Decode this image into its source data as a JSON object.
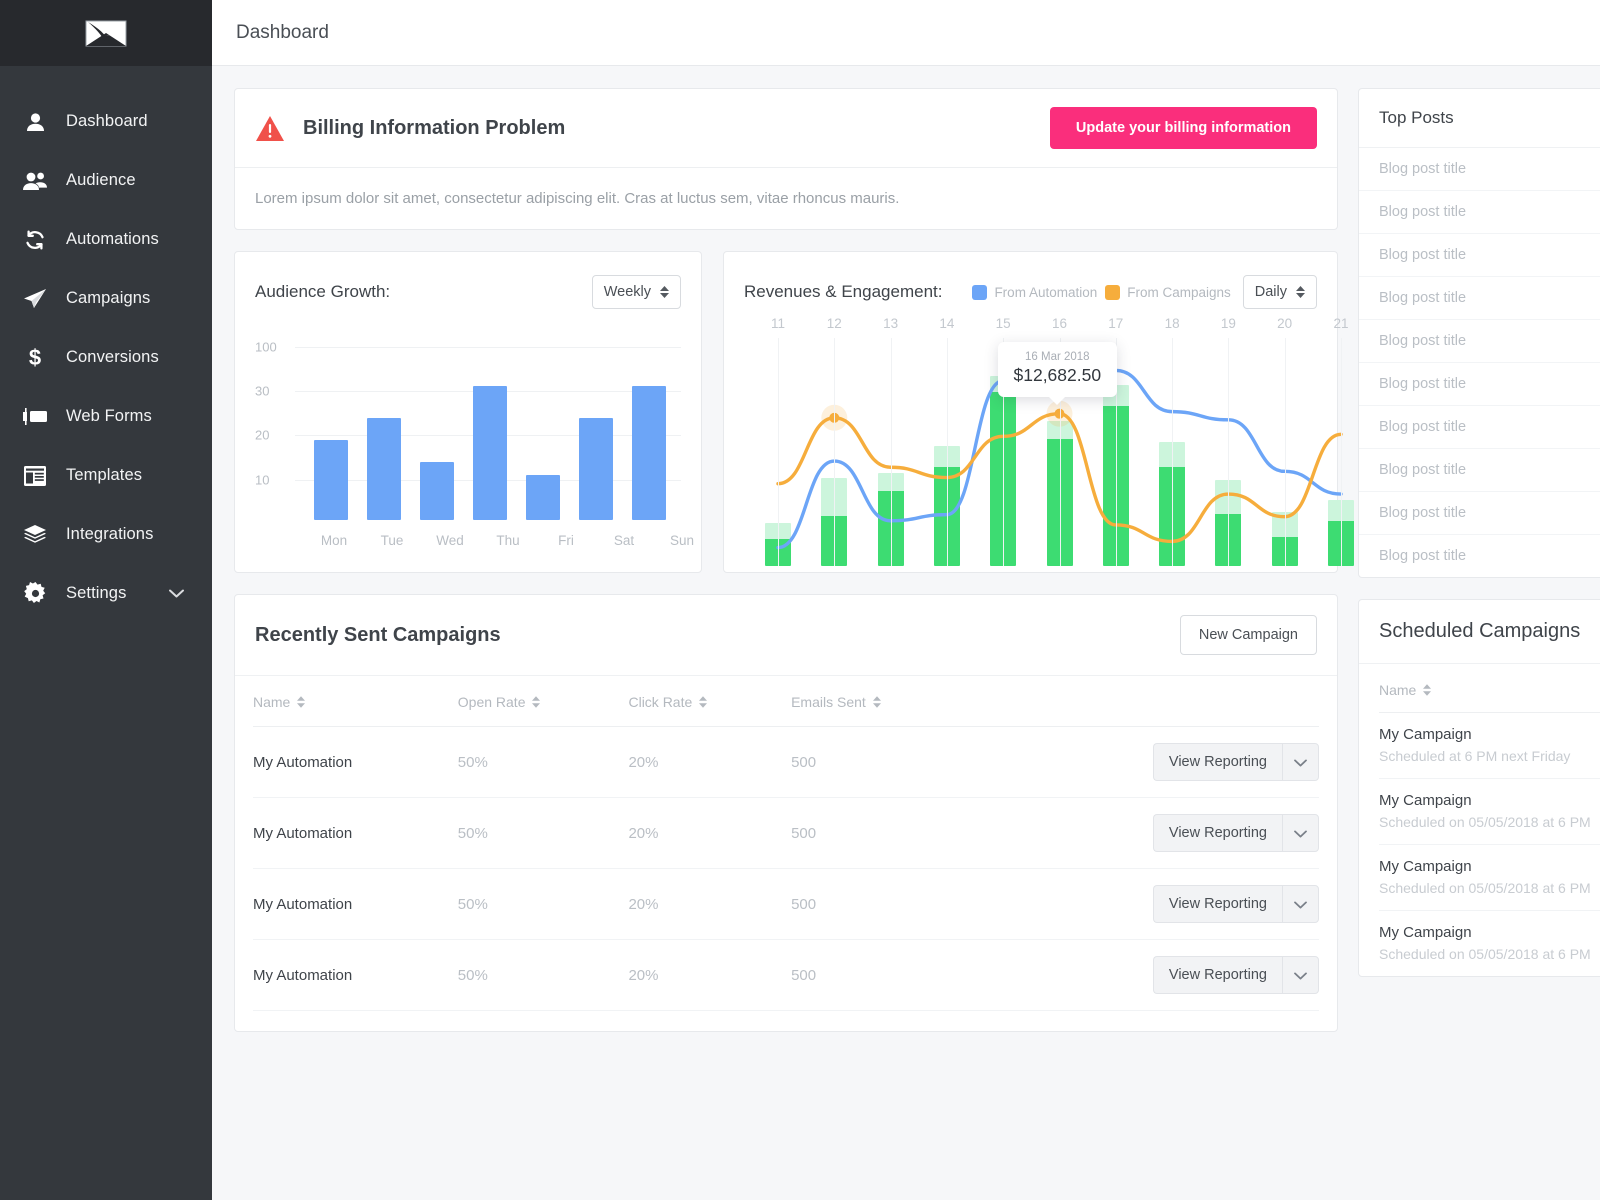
{
  "colors": {
    "brand_pink": "#FA2E7C",
    "sidebar_bg": "#34383D",
    "logo_bg": "#27292D",
    "series_blue": "#6CA5F7",
    "series_orange": "#F6AD3C",
    "bar_green": "#3DDC72",
    "bar_green_light": "#CCF5DC",
    "alert_red": "#F0514A"
  },
  "sidebar": {
    "logo_icon": "envelope-logo-icon",
    "items": [
      {
        "label": "Dashboard",
        "icon": "user-icon"
      },
      {
        "label": "Audience",
        "icon": "users-icon"
      },
      {
        "label": "Automations",
        "icon": "refresh-cycle-icon"
      },
      {
        "label": "Campaigns",
        "icon": "paper-plane-icon"
      },
      {
        "label": "Conversions",
        "icon": "dollar-sign-icon"
      },
      {
        "label": "Web Forms",
        "icon": "web-form-icon"
      },
      {
        "label": "Templates",
        "icon": "template-icon"
      },
      {
        "label": "Integrations",
        "icon": "layers-icon"
      },
      {
        "label": "Settings",
        "icon": "gear-icon",
        "caret": "chevron-down-icon"
      }
    ]
  },
  "topbar": {
    "title": "Dashboard"
  },
  "alert": {
    "icon": "warning-triangle-icon",
    "title": "Billing Information Problem",
    "button_label": "Update your billing information",
    "body": "Lorem ipsum dolor sit amet, consectetur adipiscing elit. Cras at luctus sem, vitae rhoncus mauris."
  },
  "audience": {
    "title": "Audience Growth:",
    "range_value": "Weekly"
  },
  "revenue": {
    "title": "Revenues & Engagement:",
    "range_value": "Daily",
    "legend": [
      {
        "label": "From Automation",
        "color": "#6CA5F7"
      },
      {
        "label": "From Campaigns",
        "color": "#F6AD3C"
      }
    ],
    "tooltip": {
      "date": "16 Mar 2018",
      "value": "$12,682.50"
    }
  },
  "top_posts": {
    "title": "Top Posts",
    "rows": [
      "Blog post title",
      "Blog post title",
      "Blog post title",
      "Blog post title",
      "Blog post title",
      "Blog post title",
      "Blog post title",
      "Blog post title",
      "Blog post title",
      "Blog post title"
    ]
  },
  "recent_campaigns": {
    "title": "Recently Sent Campaigns",
    "new_button": "New Campaign",
    "columns": [
      "Name",
      "Open Rate",
      "Click Rate",
      "Emails Sent"
    ],
    "action_label": "View Reporting",
    "action_caret": "chevron-down-icon",
    "rows": [
      {
        "name": "My Automation",
        "open_rate": "50%",
        "click_rate": "20%",
        "emails_sent": "500"
      },
      {
        "name": "My Automation",
        "open_rate": "50%",
        "click_rate": "20%",
        "emails_sent": "500"
      },
      {
        "name": "My Automation",
        "open_rate": "50%",
        "click_rate": "20%",
        "emails_sent": "500"
      },
      {
        "name": "My Automation",
        "open_rate": "50%",
        "click_rate": "20%",
        "emails_sent": "500"
      }
    ]
  },
  "scheduled_campaigns": {
    "title": "Scheduled Campaigns",
    "column": "Name",
    "rows": [
      {
        "name": "My Campaign",
        "sub": "Scheduled at 6 PM next Friday"
      },
      {
        "name": "My Campaign",
        "sub": "Scheduled on 05/05/2018 at 6 PM"
      },
      {
        "name": "My Campaign",
        "sub": "Scheduled on 05/05/2018 at 6 PM"
      },
      {
        "name": "My Campaign",
        "sub": "Scheduled on 05/05/2018 at 6 PM"
      }
    ]
  },
  "chart_data": [
    {
      "type": "bar",
      "title": "Audience Growth:",
      "xlabel": "",
      "ylabel": "",
      "grid": true,
      "legend": "none",
      "categories": [
        "Mon",
        "Tue",
        "Wed",
        "Thu",
        "Fri",
        "Sat",
        "Sun"
      ],
      "ytick_labels": [
        "10",
        "20",
        "30",
        "100"
      ],
      "values": [
        19,
        24,
        14,
        39,
        11,
        24,
        39
      ],
      "ylim": [
        0,
        100
      ]
    },
    {
      "type": "bar+line",
      "title": "Revenues & Engagement:",
      "xlabel": "",
      "ylabel": "",
      "grid": true,
      "legend": "top-right",
      "x": [
        "11",
        "12",
        "13",
        "14",
        "15",
        "16",
        "17",
        "18",
        "19",
        "20",
        "21"
      ],
      "bars": {
        "name": "Revenue",
        "color": "#3DDC72",
        "cap_color": "#CCF5DC",
        "values": [
          12,
          22,
          33,
          44,
          77,
          56,
          71,
          44,
          23,
          13,
          20
        ],
        "cap_values": [
          19,
          39,
          41,
          53,
          84,
          64,
          80,
          55,
          38,
          24,
          29
        ]
      },
      "series": [
        {
          "name": "From Automation",
          "color": "#6CA5F7",
          "values": [
            7,
            49,
            20,
            23,
            88,
            94,
            93,
            73,
            69,
            44,
            33
          ]
        },
        {
          "name": "From Campaigns",
          "color": "#F6AD3C",
          "values": [
            38,
            70,
            46,
            41,
            61,
            72,
            18,
            10,
            33,
            22,
            62
          ]
        }
      ],
      "annotation": {
        "x": "16",
        "date": "16 Mar 2018",
        "value": "$12,682.50"
      }
    }
  ]
}
